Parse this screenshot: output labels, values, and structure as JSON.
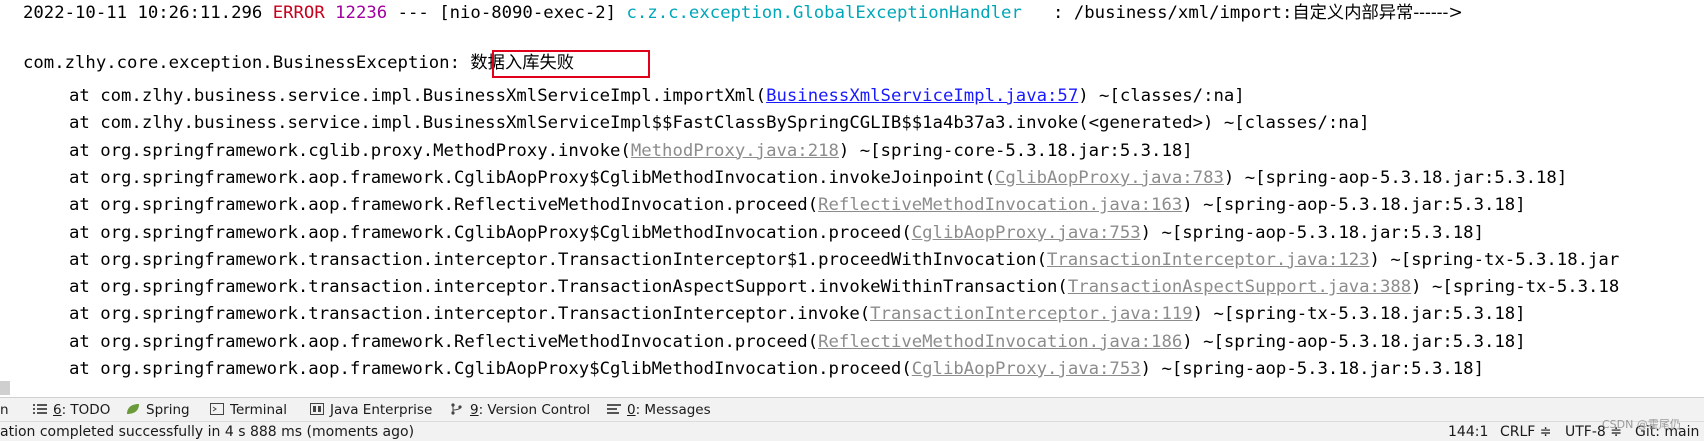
{
  "console": {
    "header": {
      "timestamp": "2022-10-11 10:26:11.296",
      "level": "ERROR",
      "pid": "12236",
      "separator": "---",
      "thread": "[nio-8090-exec-2]",
      "logger": "c.z.c.exception.GlobalExceptionHandler",
      "message_prefix": "  : /business/xml/import:",
      "message_cjk": "自定义内部异常------>"
    },
    "exception": {
      "class": "com.zlhy.core.exception.BusinessException:",
      "message": "数据入库失败"
    },
    "frames": [
      {
        "method": "at com.zlhy.business.service.impl.BusinessXmlServiceImpl.importXml(",
        "link": "BusinessXmlServiceImpl.java:57",
        "rest": ") ~[classes/:na]"
      },
      {
        "method": "at com.zlhy.business.service.impl.BusinessXmlServiceImpl$$FastClassBySpringCGLIB$$1a4b37a3.invoke(<generated>) ~[classes/:na]",
        "link": "",
        "rest": ""
      },
      {
        "method": "at org.springframework.cglib.proxy.MethodProxy.invoke(",
        "link": "MethodProxy.java:218",
        "rest": ") ~[spring-core-5.3.18.jar:5.3.18]"
      },
      {
        "method": "at org.springframework.aop.framework.CglibAopProxy$CglibMethodInvocation.invokeJoinpoint(",
        "link": "CglibAopProxy.java:783",
        "rest": ") ~[spring-aop-5.3.18.jar:5.3.18]"
      },
      {
        "method": "at org.springframework.aop.framework.ReflectiveMethodInvocation.proceed(",
        "link": "ReflectiveMethodInvocation.java:163",
        "rest": ") ~[spring-aop-5.3.18.jar:5.3.18]"
      },
      {
        "method": "at org.springframework.aop.framework.CglibAopProxy$CglibMethodInvocation.proceed(",
        "link": "CglibAopProxy.java:753",
        "rest": ") ~[spring-aop-5.3.18.jar:5.3.18]"
      },
      {
        "method": "at org.springframework.transaction.interceptor.TransactionInterceptor$1.proceedWithInvocation(",
        "link": "TransactionInterceptor.java:123",
        "rest": ") ~[spring-tx-5.3.18.jar"
      },
      {
        "method": "at org.springframework.transaction.interceptor.TransactionAspectSupport.invokeWithinTransaction(",
        "link": "TransactionAspectSupport.java:388",
        "rest": ") ~[spring-tx-5.3.18"
      },
      {
        "method": "at org.springframework.transaction.interceptor.TransactionInterceptor.invoke(",
        "link": "TransactionInterceptor.java:119",
        "rest": ") ~[spring-tx-5.3.18.jar:5.3.18]"
      },
      {
        "method": "at org.springframework.aop.framework.ReflectiveMethodInvocation.proceed(",
        "link": "ReflectiveMethodInvocation.java:186",
        "rest": ") ~[spring-aop-5.3.18.jar:5.3.18]"
      },
      {
        "method": "at org.springframework.aop.framework.CglibAopProxy$CglibMethodInvocation.proceed(",
        "link": "CglibAopProxy.java:753",
        "rest": ") ~[spring-aop-5.3.18.jar:5.3.18]"
      }
    ]
  },
  "toolwindows": {
    "run_fragment": "n",
    "todo_key": "6",
    "todo_label": ": TODO",
    "spring": "Spring",
    "terminal": "Terminal",
    "java_enterprise": "Java Enterprise",
    "vcs_key": "9",
    "vcs_label": ": Version Control",
    "messages_key": "0",
    "messages_label": ": Messages"
  },
  "statusbar": {
    "message": "ation completed successfully in 4 s 888 ms (moments ago)",
    "position": "144:1",
    "line_separator": "CRLF ≑",
    "encoding": "UTF-8 ≑",
    "git": "Git: main"
  },
  "watermark": "CSDN @霍尾仍",
  "colors": {
    "error": "#c7001c",
    "pid": "#a000a0",
    "logger": "#00a7b8",
    "link": "#1a1aff",
    "highlight_box": "#e0001b"
  }
}
